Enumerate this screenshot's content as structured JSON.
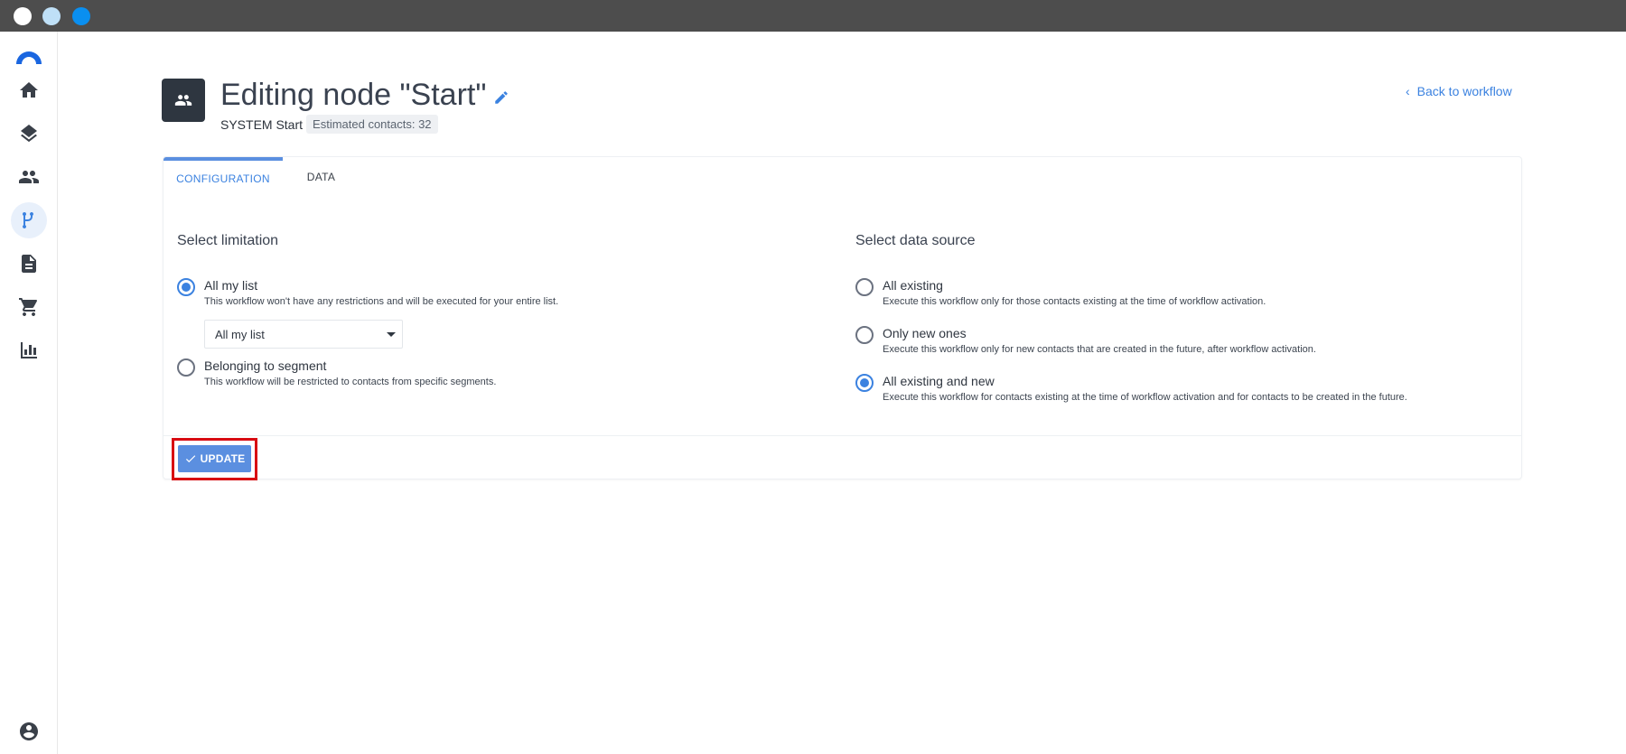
{
  "window": {
    "controls": [
      "close",
      "minimize",
      "maximize"
    ]
  },
  "sidebar": {
    "items": [
      {
        "name": "home",
        "icon": "home-icon",
        "active": false
      },
      {
        "name": "layers",
        "icon": "layers-icon",
        "active": false
      },
      {
        "name": "contacts",
        "icon": "people-icon",
        "active": false
      },
      {
        "name": "workflows",
        "icon": "workflow-branch-icon",
        "active": true
      },
      {
        "name": "documents",
        "icon": "document-icon",
        "active": false
      },
      {
        "name": "shop",
        "icon": "cart-icon",
        "active": false
      },
      {
        "name": "reports",
        "icon": "bar-chart-icon",
        "active": false
      }
    ],
    "user_icon": "account-circle-icon"
  },
  "header": {
    "title": "Editing node \"Start\"",
    "node_type": "SYSTEM Start",
    "estimated_contacts": "Estimated contacts: 32",
    "back_link": "Back to workflow"
  },
  "tabs": [
    {
      "label": "CONFIGURATION",
      "active": true
    },
    {
      "label": "DATA",
      "active": false
    }
  ],
  "limitation": {
    "title": "Select limitation",
    "options": [
      {
        "label": "All my list",
        "desc": "This workflow won't have any restrictions and will be executed for your entire list.",
        "checked": true
      },
      {
        "label": "Belonging to segment",
        "desc": "This workflow will be restricted to contacts from specific segments.",
        "checked": false
      }
    ],
    "list_select_value": "All my list"
  },
  "data_source": {
    "title": "Select data source",
    "options": [
      {
        "label": "All existing",
        "desc": "Execute this workflow only for those contacts existing at the time of workflow activation.",
        "checked": false
      },
      {
        "label": "Only new ones",
        "desc": "Execute this workflow only for new contacts that are created in the future, after workflow activation.",
        "checked": false
      },
      {
        "label": "All existing and new",
        "desc": "Execute this workflow for contacts existing at the time of workflow activation and for contacts to be created in the future.",
        "checked": true
      }
    ]
  },
  "footer": {
    "update_label": "UPDATE"
  },
  "colors": {
    "accent": "#3b82e0",
    "button": "#5b8fe0",
    "highlight": "#d80b12",
    "badge": "#2e3640"
  }
}
